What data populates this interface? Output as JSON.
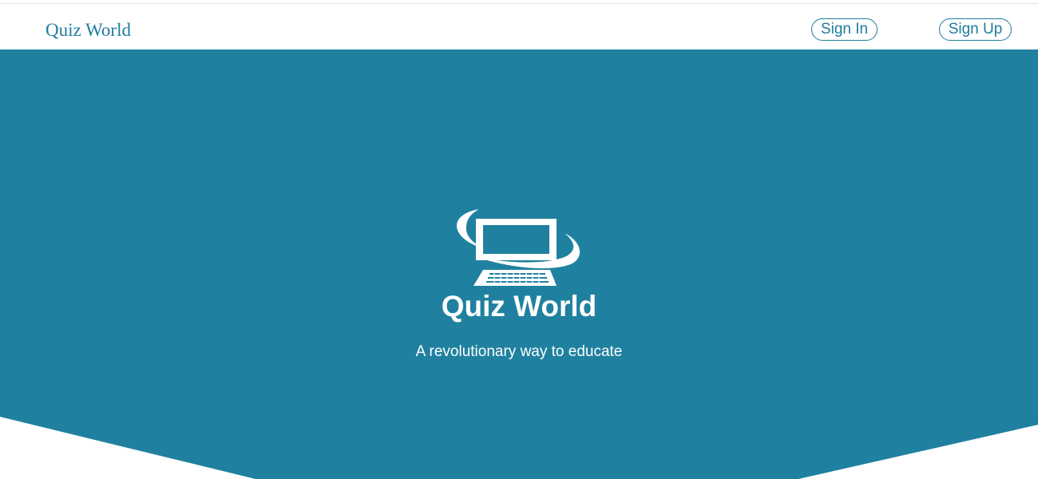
{
  "navbar": {
    "brand": "Quiz World",
    "sign_in_label": "Sign In",
    "sign_up_label": "Sign Up"
  },
  "hero": {
    "logo_icon": "computer-monitor-orbit-icon",
    "title": "Quiz World",
    "subtitle": "A revolutionary way to educate"
  },
  "colors": {
    "brand": "#1f7d9e",
    "hero_background": "#1f819f",
    "hero_text": "#ffffff",
    "page_background": "#ffffff"
  }
}
